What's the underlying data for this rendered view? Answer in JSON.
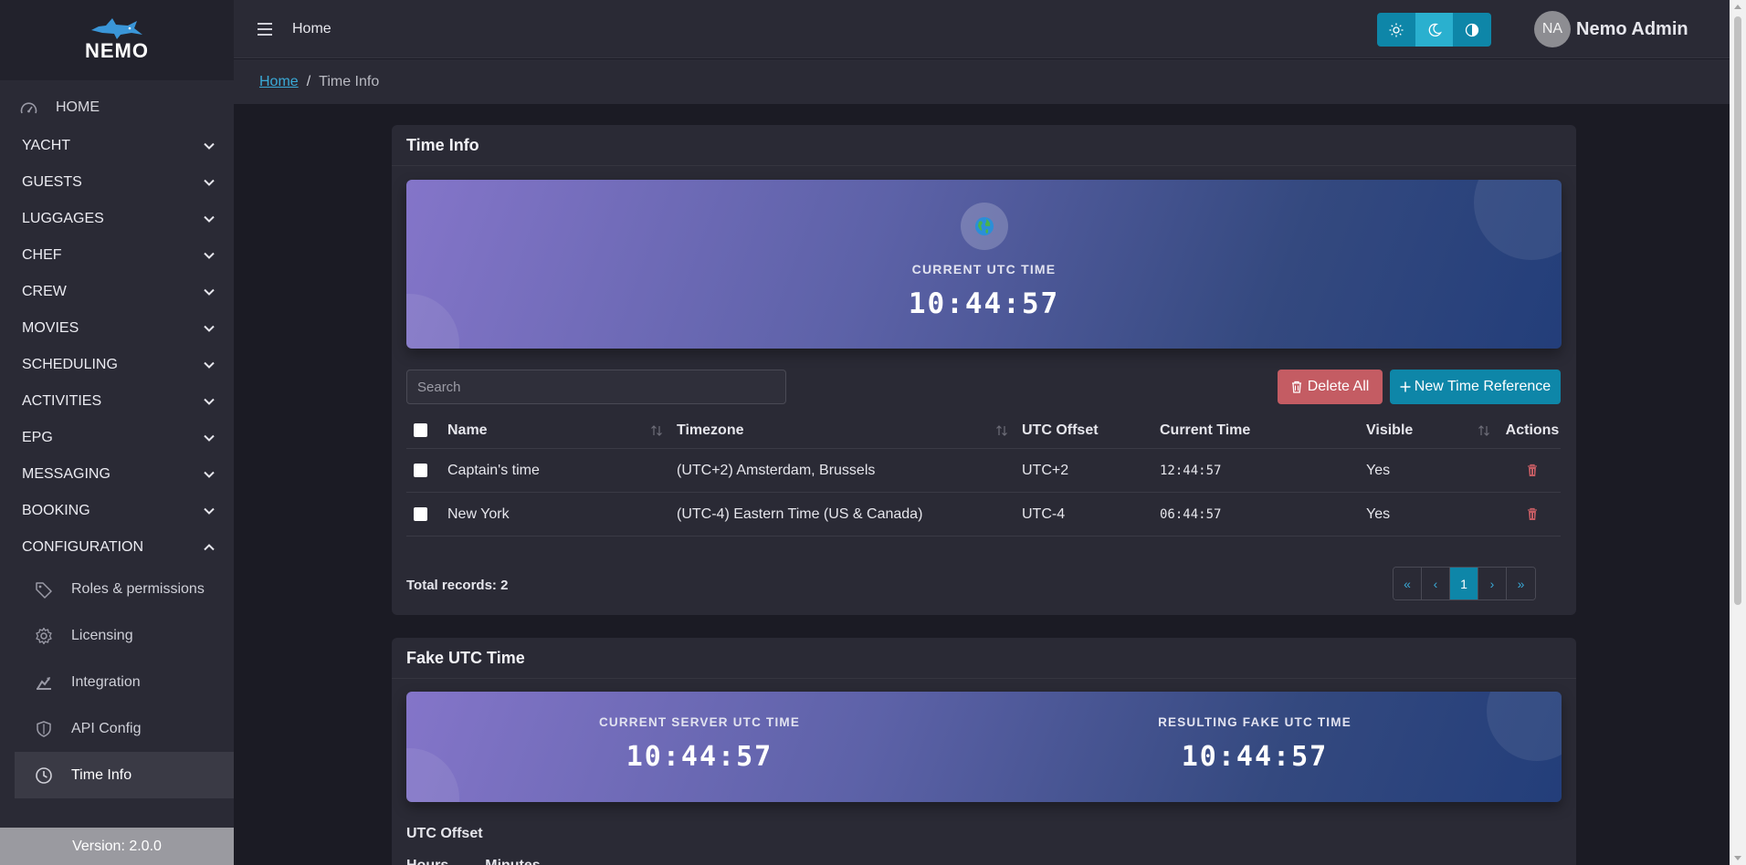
{
  "app": {
    "logo_text": "NEMO",
    "version": "Version: 2.0.0"
  },
  "sidebar": {
    "home_label": "HOME",
    "items": [
      {
        "label": "YACHT"
      },
      {
        "label": "GUESTS"
      },
      {
        "label": "LUGGAGES"
      },
      {
        "label": "CHEF"
      },
      {
        "label": "CREW"
      },
      {
        "label": "MOVIES"
      },
      {
        "label": "SCHEDULING"
      },
      {
        "label": "ACTIVITIES"
      },
      {
        "label": "EPG"
      },
      {
        "label": "MESSAGING"
      },
      {
        "label": "BOOKING"
      },
      {
        "label": "CONFIGURATION",
        "expanded": true
      }
    ],
    "sub_items": [
      {
        "label": "Roles & permissions",
        "icon": "tag-icon"
      },
      {
        "label": "Licensing",
        "icon": "gear-icon"
      },
      {
        "label": "Integration",
        "icon": "integration-icon"
      },
      {
        "label": "API Config",
        "icon": "shield-icon"
      },
      {
        "label": "Time Info",
        "icon": "clock-icon",
        "active": true
      }
    ]
  },
  "topbar": {
    "title": "Home",
    "theme_buttons": [
      "sun-icon",
      "moon-icon",
      "contrast-icon"
    ],
    "active_theme": "moon-icon",
    "user": {
      "initials": "NA",
      "name": "Nemo Admin"
    }
  },
  "breadcrumb": {
    "home": "Home",
    "separator": "/",
    "current": "Time Info"
  },
  "time_info": {
    "title": "Time Info",
    "hero": {
      "icon": "globe-icon",
      "label": "CURRENT UTC TIME",
      "time": "10:44:57"
    },
    "search_placeholder": "Search",
    "delete_all_label": "Delete All",
    "new_reference_label": "New Time Reference",
    "columns": {
      "name": "Name",
      "timezone": "Timezone",
      "utc_offset": "UTC Offset",
      "current_time": "Current Time",
      "visible": "Visible",
      "actions": "Actions"
    },
    "rows": [
      {
        "name": "Captain's time",
        "timezone": "(UTC+2) Amsterdam, Brussels",
        "utc_offset": "UTC+2",
        "current_time": "12:44:57",
        "visible": "Yes"
      },
      {
        "name": "New York",
        "timezone": "(UTC-4) Eastern Time (US & Canada)",
        "utc_offset": "UTC-4",
        "current_time": "06:44:57",
        "visible": "Yes"
      }
    ],
    "total_records": "Total records: 2",
    "pagination": {
      "first": "«",
      "prev": "‹",
      "current": "1",
      "next": "›",
      "last": "»"
    }
  },
  "fake_utc": {
    "title": "Fake UTC Time",
    "server_label": "CURRENT SERVER UTC TIME",
    "server_time": "10:44:57",
    "fake_label": "RESULTING FAKE UTC TIME",
    "fake_time": "10:44:57",
    "utc_offset_label": "UTC Offset",
    "hours_label": "Hours",
    "minutes_label": "Minutes"
  },
  "colors": {
    "accent": "#0e86a8",
    "danger": "#c45c63",
    "link": "#3aa9d6",
    "sidebar_bg": "#2a2a35",
    "page_bg": "#1b1b24"
  }
}
